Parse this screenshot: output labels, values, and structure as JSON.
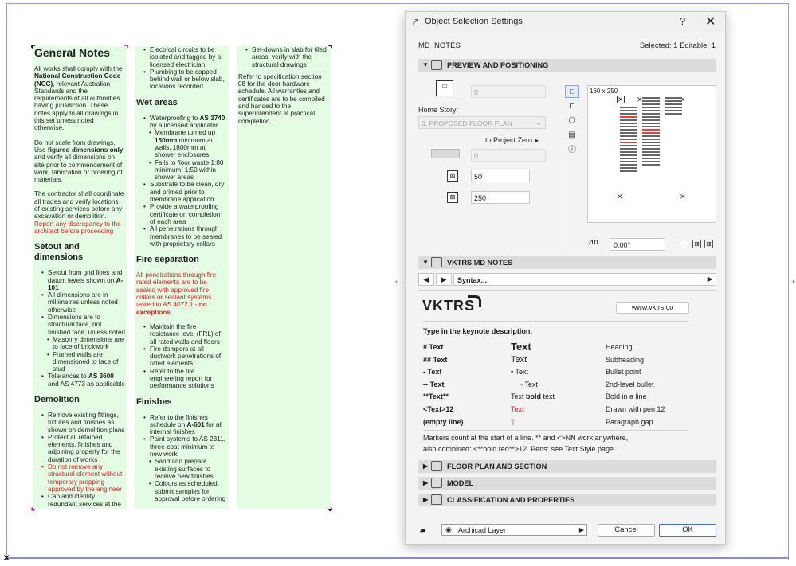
{
  "notes": {
    "col1": {
      "title": "General Notes",
      "p1_a": "All works shall comply with the ",
      "p1_b": "National Construction Code (NCC)",
      "p1_c": ", relevant Australian Standards and the requirements of all authorities having jurisdiction. These notes apply to all drawings in this set unless noted otherwise.",
      "p2_a": "Do not scale from drawings. Use ",
      "p2_b": "figured dimensions only",
      "p2_c": " and verify all dimensions on site prior to commencement of work, fabrication or ordering of materials.",
      "p3_a": "The contractor shall coordinate all trades and verify locations of existing services before any excavation or demolition. ",
      "p3_b": "Report any discrepancy to the architect before proceeding",
      "h_setout": "Setout and dimensions",
      "s1_a": "Setout from grid lines and datum levels shown on ",
      "s1_b": "A-101",
      "s2": "All dimensions are in millimetres unless noted otherwise",
      "s3": "Dimensions are to structural face, not finished face, unless noted",
      "s3a": "Masonry dimensions are to face of brickwork",
      "s3b": "Framed walls are dimensioned to face of stud",
      "s4_a": "Tolerances to ",
      "s4_b": "AS 3600",
      "s4_c": " and AS 4773 as applicable",
      "h_demo": "Demolition",
      "d1": "Remove existing fittings, fixtures and finishes as shown on demolition plans",
      "d2": "Protect all retained elements, finishes and adjoining property for the duration of works",
      "d3": "Do not remove any structural element without temporary propping approved by the engineer",
      "d4": "Cap and identify redundant services at the point of supply"
    },
    "col2": {
      "e1": "Electrical circuits to be isolated and tagged by a licensed electrician",
      "e2": "Plumbing to be capped behind wall or below slab, locations recorded",
      "h_wet": "Wet areas",
      "w1_a": "Waterproofing to ",
      "w1_b": "AS 3740",
      "w1_c": " by a licensed applicator",
      "w1a_a": "Membrane turned up ",
      "w1a_b": "150mm",
      "w1a_c": " minimum at walls, 1800mm at shower enclosures",
      "w1b": "Falls to floor waste 1:80 minimum, 1:50 within shower areas",
      "w2": "Substrate to be clean, dry and primed prior to membrane application",
      "w3": "Provide a waterproofing certificate on completion of each area",
      "w4": "All penetrations through membranes to be sealed with proprietary collars",
      "h_fire": "Fire separation",
      "fire_red_a": "All penetrations through fire-rated elements are to be sealed with approved fire collars or sealant systems tested to AS 4072.1 - ",
      "fire_red_b": "no exceptions",
      "f1": "Maintain the fire resistance level (FRL) of all rated walls and floors",
      "f2": "Fire dampers at all ductwork penetrations of rated elements",
      "f3": "Refer to the fire engineering report for performance solutions",
      "h_fin": "Finishes",
      "n1_a": "Refer to the finishes schedule on ",
      "n1_b": "A-601",
      "n1_c": " for all internal finishes",
      "n2": "Paint systems to AS 2311, three-coat minimum to new work",
      "n2a": "Sand and prepare existing surfaces to receive new finishes",
      "n2b": "Colours as scheduled, submit samples for approval before ordering"
    },
    "col3": {
      "t1": "Set-downs in slab for tiled areas: verify with the structural drawings",
      "p1": "Refer to specification section 08 for the door hardware schedule. All warranties and certificates are to be compiled and handed to the superintendent at practical completion."
    }
  },
  "dialog": {
    "title": "Object Selection Settings",
    "help": "?",
    "close": "✕",
    "object_name": "MD_NOTES",
    "selection_info": "Selected: 1 Editable: 1",
    "preview_section": "PREVIEW AND POSITIONING",
    "elevation_value": "0",
    "home_story_label": "Home Story:",
    "home_story_value": "0. PROPOSED FLOOR PLAN",
    "to_project_zero": "to Project Zero",
    "offset_value": "0",
    "width_value": "50",
    "height_value": "250",
    "preview_dims": "160 x 250",
    "rotation_value": "0.00°",
    "notes_section": "VKTRS MD NOTES",
    "syntax_label": "Syntax...",
    "logo_text": "VKTRS",
    "url": "www.vktrs.co",
    "intro": "Type in the keynote description:",
    "syntax_rows": [
      {
        "code": "# Text",
        "example": "Text",
        "meaning": "Heading"
      },
      {
        "code": "## Text",
        "example": "Text",
        "meaning": "Subheading"
      },
      {
        "code": "- Text",
        "example": "•  Text",
        "meaning": "Bullet point"
      },
      {
        "code": "-- Text",
        "example": "◦  Text",
        "meaning": "2nd-level bullet"
      },
      {
        "code": "**Text**",
        "example_a": "Text ",
        "example_b": "bold",
        "example_c": " text",
        "meaning": "Bold in a line"
      },
      {
        "code": "<Text>12",
        "example": "Text",
        "meaning": "Drawn with pen 12"
      },
      {
        "code": "(empty line)",
        "example": "¶",
        "meaning": "Paragraph gap"
      }
    ],
    "footnote1": "Markers count at the start of a line. ** and <>NN work anywhere,",
    "footnote2": "also combined: <**bold red**>12. Pens: see Text Style page.",
    "floor_section": "FLOOR PLAN AND SECTION",
    "model_section": "MODEL",
    "class_section": "CLASSIFICATION AND PROPERTIES",
    "layer_value": "Archicad Layer",
    "cancel": "Cancel",
    "ok": "OK"
  },
  "colors": {
    "note_bg": "#e4fbe4",
    "red_text": "#d42020",
    "accent": "#3b6fc6"
  }
}
